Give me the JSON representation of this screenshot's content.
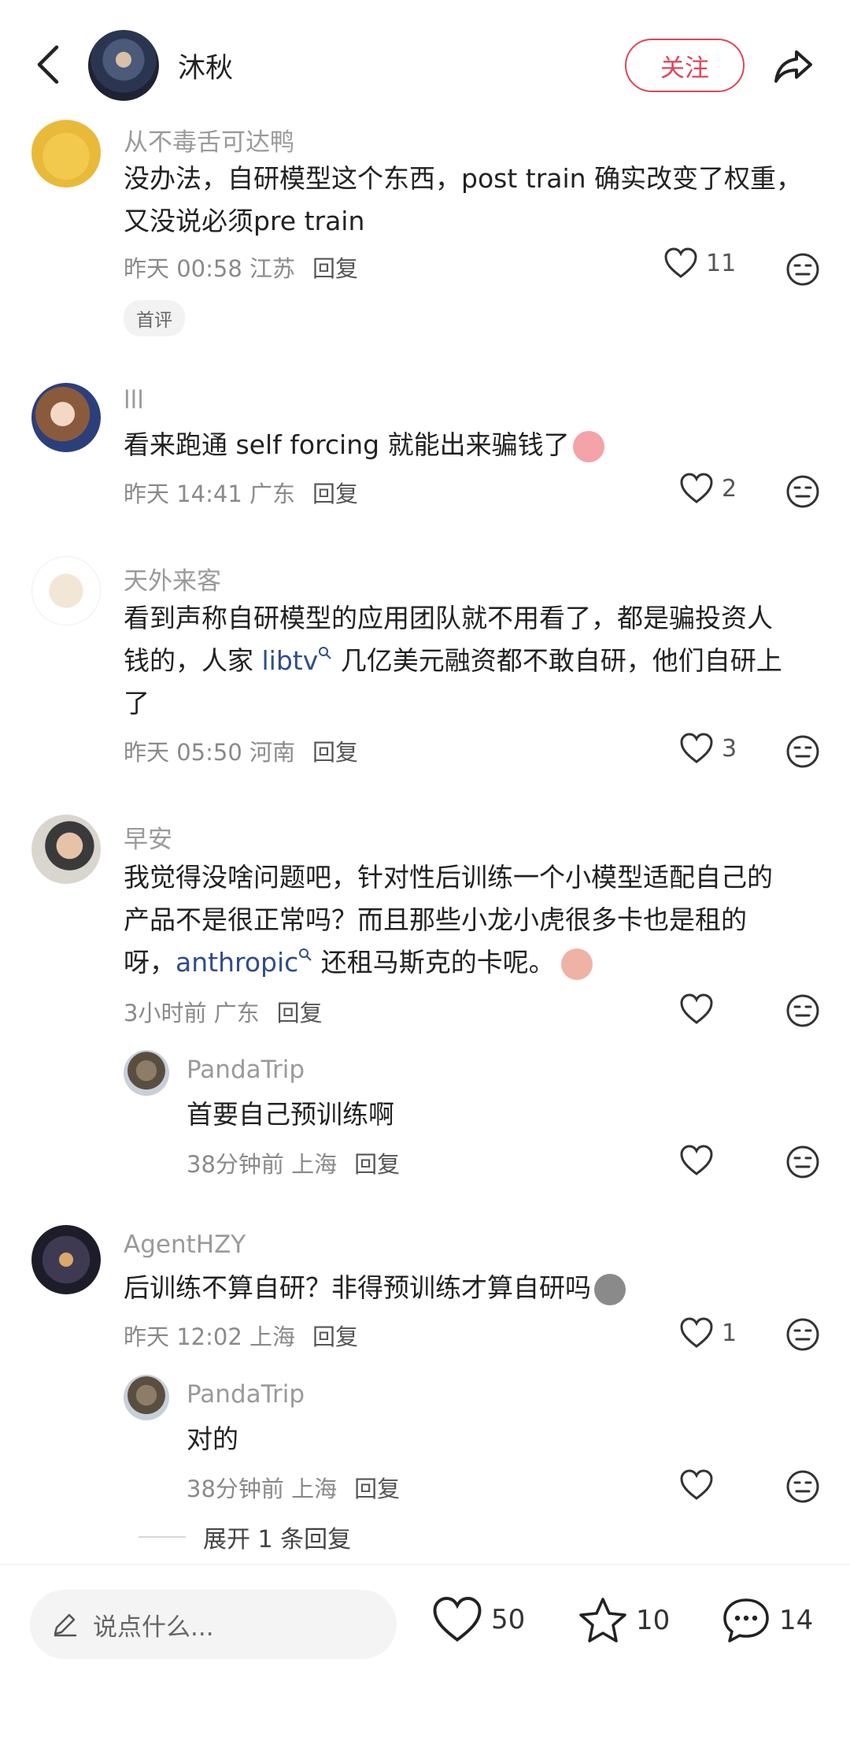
{
  "header": {
    "author_name": "沐秋",
    "follow_label": "关注"
  },
  "comments": [
    {
      "user": "从不毒舌可达鸭",
      "text_lines": [
        "没办法，自研模型这个东西，post train 确实改变了权重，",
        "又没说必须pre train"
      ],
      "time": "昨天 00:58 江苏",
      "reply": "回复",
      "likes": "11",
      "badge": "首评"
    },
    {
      "user": "lll",
      "text": "看来跑通 self forcing 就能出来骗钱了",
      "time": "昨天 14:41 广东",
      "reply": "回复",
      "likes": "2"
    },
    {
      "user": "天外来客",
      "line1": "看到声称自研模型的应用团队就不用看了，都是骗投资人",
      "line2_pre": "钱的，人家 ",
      "line2_link": "libtv",
      "line2_post": " 几亿美元融资都不敢自研，他们自研上",
      "line3": "了",
      "time": "昨天 05:50 河南",
      "reply": "回复",
      "likes": "3"
    },
    {
      "user": "早安",
      "line1": "我觉得没啥问题吧，针对性后训练一个小模型适配自己的",
      "line2": "产品不是很正常吗？而且那些小龙小虎很多卡也是租的",
      "line3_pre": "呀，",
      "line3_link": "anthropic",
      "line3_post": " 还租马斯克的卡呢。",
      "time": "3小时前 广东",
      "reply": "回复",
      "likes": ""
    },
    {
      "user": "PandaTrip",
      "text": "首要自己预训练啊",
      "time": "38分钟前 上海",
      "reply": "回复",
      "likes": ""
    },
    {
      "user": "AgentHZY",
      "text": "后训练不算自研？非得预训练才算自研吗",
      "time": "昨天 12:02 上海",
      "reply": "回复",
      "likes": "1"
    },
    {
      "user": "PandaTrip",
      "text": "对的",
      "time": "38分钟前 上海",
      "reply": "回复",
      "likes": ""
    }
  ],
  "expand_label": "展开 1 条回复",
  "bottom": {
    "input_placeholder": "说点什么...",
    "likes": "50",
    "stars": "10",
    "comments": "14"
  },
  "colors": {
    "accent": "#e0455a",
    "link": "#2f4d8a"
  }
}
